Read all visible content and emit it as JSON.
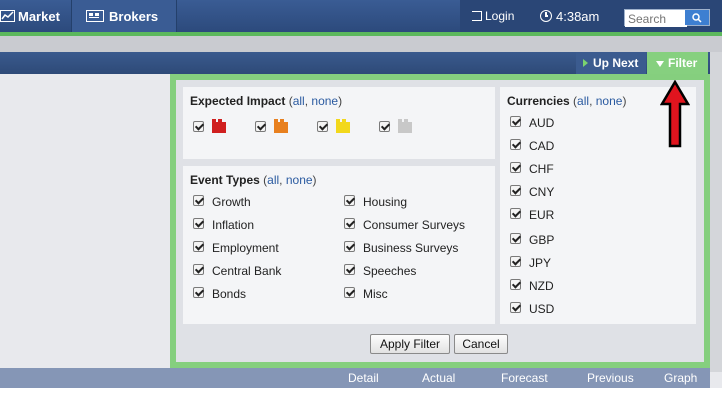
{
  "nav": {
    "market": "Market",
    "brokers": "Brokers",
    "login": "Login",
    "time": "4:38am",
    "search_placeholder": "Search"
  },
  "toolbar": {
    "up_next": "Up Next",
    "filter": "Filter"
  },
  "filter": {
    "impact": {
      "title": "Expected Impact",
      "all": "all",
      "none": "none",
      "levels": [
        {
          "name": "high",
          "color": "#d01f1f",
          "checked": true
        },
        {
          "name": "medium",
          "color": "#e8801f",
          "checked": true
        },
        {
          "name": "low",
          "color": "#f2d81c",
          "checked": true
        },
        {
          "name": "non-economic",
          "color": "#c8c8c8",
          "checked": true
        }
      ]
    },
    "event_types": {
      "title": "Event Types",
      "all": "all",
      "none": "none",
      "items": [
        "Growth",
        "Inflation",
        "Employment",
        "Central Bank",
        "Bonds",
        "Housing",
        "Consumer Surveys",
        "Business Surveys",
        "Speeches",
        "Misc"
      ]
    },
    "currencies": {
      "title": "Currencies",
      "all": "all",
      "none": "none",
      "items": [
        "AUD",
        "CAD",
        "CHF",
        "CNY",
        "EUR",
        "GBP",
        "JPY",
        "NZD",
        "USD"
      ]
    },
    "apply_label": "Apply Filter",
    "cancel_label": "Cancel"
  },
  "table": {
    "columns": [
      "Detail",
      "Actual",
      "Forecast",
      "Previous",
      "Graph"
    ]
  },
  "colors": {
    "nav_blue": "#2c4a7c",
    "accent_green": "#85cf7e",
    "arrow_red": "#e0141e",
    "link_blue": "#2a5aa0"
  }
}
